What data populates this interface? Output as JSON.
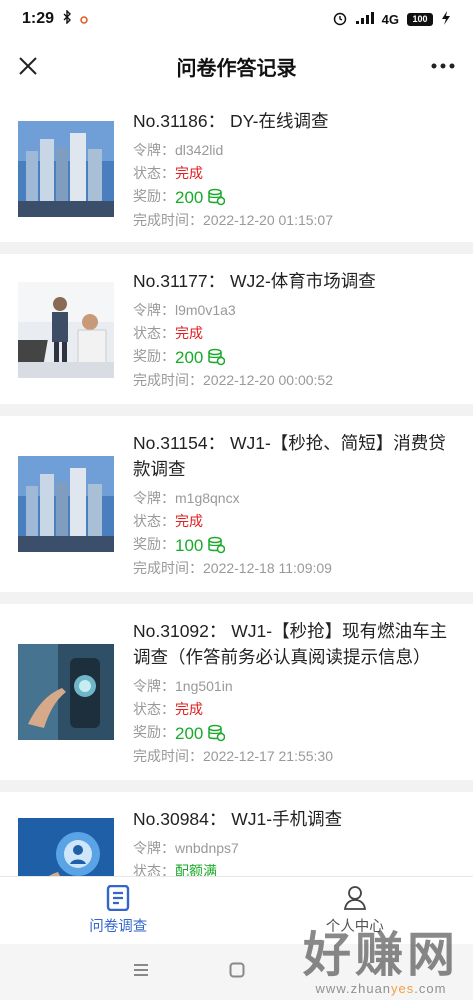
{
  "status_bar": {
    "time": "1:29",
    "network": "4G",
    "battery": "100"
  },
  "header": {
    "title": "问卷作答记录"
  },
  "labels": {
    "token": "令牌：",
    "status": "状态：",
    "reward": "奖励：",
    "finished_time": "完成时间："
  },
  "records": [
    {
      "title": "No.31186： DY-在线调查",
      "token": "dl342lid",
      "status": "完成",
      "reward": "200",
      "finished_time": "2022-12-20 01:15:07",
      "image": "city-skyline"
    },
    {
      "title": "No.31177： WJ2-体育市场调查",
      "token": "l9m0v1a3",
      "status": "完成",
      "reward": "200",
      "finished_time": "2022-12-20 00:00:52",
      "image": "office-people"
    },
    {
      "title": "No.31154： WJ1-【秒抢、简短】消费贷款调查",
      "token": "m1g8qncx",
      "status": "完成",
      "reward": "100",
      "finished_time": "2022-12-18 11:09:09",
      "image": "city-skyline"
    },
    {
      "title": "No.31092： WJ1-【秒抢】现有燃油车主调查（作答前务必认真阅读提示信息）",
      "token": "1ng501in",
      "status": "完成",
      "reward": "200",
      "finished_time": "2022-12-17 21:55:30",
      "image": "touch-device"
    },
    {
      "title": "No.30984： WJ1-手机调查",
      "token": "wnbdnps7",
      "status": "配额满",
      "image": "phone-tech"
    }
  ],
  "tabs": [
    {
      "label": "问卷调查",
      "icon": "survey-icon",
      "active": true
    },
    {
      "label": "个人中心",
      "icon": "person-icon",
      "active": false
    }
  ],
  "watermark": {
    "big": "好赚网",
    "small_pre": "www.zhuan",
    "small_hl": "yes",
    "small_post": ".com"
  },
  "colors": {
    "accent": "#3366cc",
    "reward": "#1aaa2a",
    "done": "#e02020"
  }
}
